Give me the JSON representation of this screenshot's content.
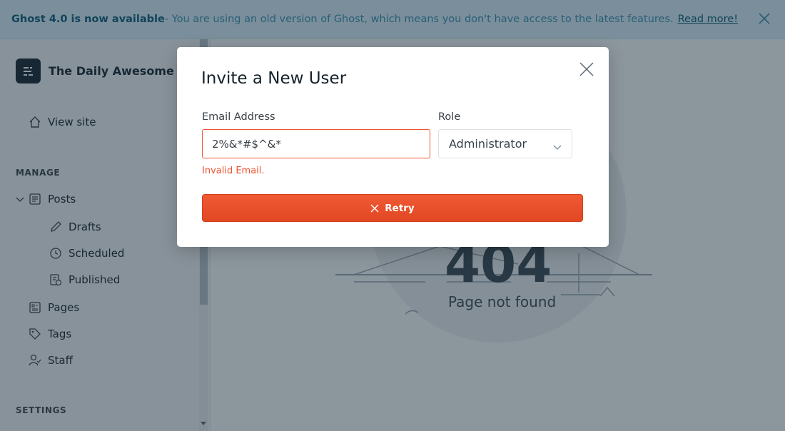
{
  "banner": {
    "bold": "Ghost 4.0 is now available",
    "message": " - You are using an old version of Ghost, which means you don't have access to the latest features.",
    "link": "Read more!"
  },
  "sidebar": {
    "brand": "The Daily Awesome",
    "view_site": "View site",
    "manage_label": "MANAGE",
    "posts": "Posts",
    "drafts": "Drafts",
    "scheduled": "Scheduled",
    "published": "Published",
    "pages": "Pages",
    "tags": "Tags",
    "staff": "Staff",
    "settings_label": "SETTINGS"
  },
  "main": {
    "code": "404",
    "message": "Page not found"
  },
  "modal": {
    "title": "Invite a New User",
    "email_label": "Email Address",
    "email_value": "2%&*#$^&*",
    "error": "Invalid Email.",
    "role_label": "Role",
    "role_value": "Administrator",
    "retry_label": "Retry"
  },
  "colors": {
    "accent": "#f05230",
    "banner_bg": "#daf1fb",
    "overlay": "#192d3c"
  }
}
